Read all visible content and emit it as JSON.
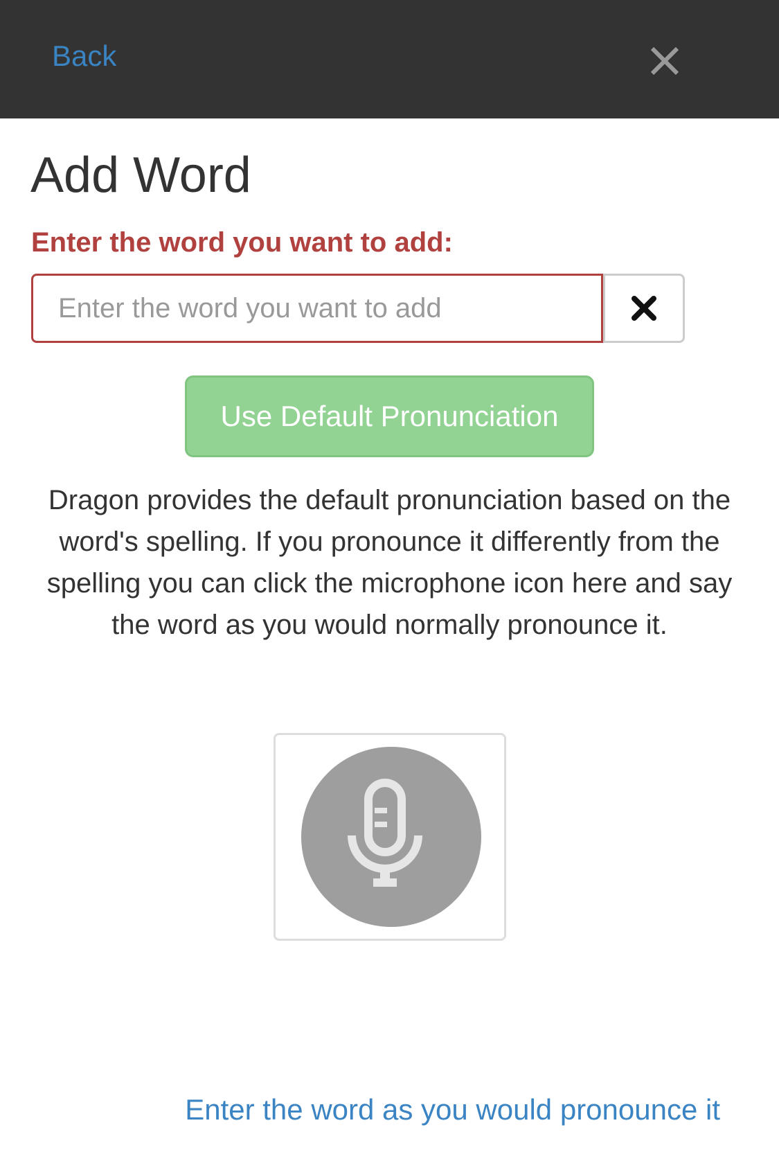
{
  "header": {
    "back_label": "Back",
    "close_icon": "close-icon"
  },
  "page": {
    "title": "Add Word"
  },
  "form": {
    "label": "Enter the word you want to add:",
    "input_value": "",
    "input_placeholder": "Enter the word you want to add",
    "clear_icon": "clear-x-icon"
  },
  "pronunciation": {
    "default_button_label": "Use Default Pronunciation",
    "description": "Dragon provides the default pronunciation based on the word's spelling. If you pronounce it differently from the spelling you can click the microphone icon here and say the word as you would normally pronounce it.",
    "mic_icon": "microphone-icon",
    "alt_link_label": "Enter the word as you would pronounce it"
  },
  "colors": {
    "header_bg": "#333333",
    "link": "#3a84c4",
    "label_error": "#b0413e",
    "button_green": "#92d293",
    "mic_gray": "#9e9e9e"
  }
}
